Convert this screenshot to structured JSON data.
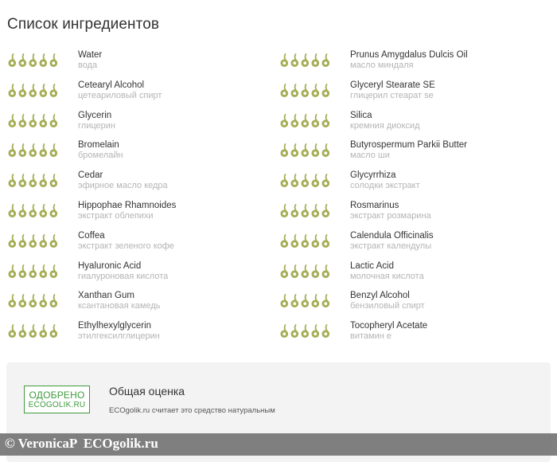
{
  "page": {
    "title": "Список ингредиентов"
  },
  "colors": {
    "drop_fill": "#a5ad55",
    "badge_green": "#3f9a3d"
  },
  "icons": {
    "rating": "drop-icon"
  },
  "ingredients": [
    {
      "name": "Water",
      "translation": "вода",
      "rating": 5
    },
    {
      "name": "Prunus Amygdalus Dulcis Oil",
      "translation": "масло миндаля",
      "rating": 5
    },
    {
      "name": "Cetearyl Alcohol",
      "translation": "цетеариловый спирт",
      "rating": 5
    },
    {
      "name": "Glyceryl Stearate SE",
      "translation": "глицерил стеарат se",
      "rating": 5
    },
    {
      "name": "Glycerin",
      "translation": "глицерин",
      "rating": 5
    },
    {
      "name": "Silica",
      "translation": "кремния диоксид",
      "rating": 5
    },
    {
      "name": "Bromelain",
      "translation": "бромелайн",
      "rating": 5
    },
    {
      "name": "Butyrospermum Parkii Butter",
      "translation": "масло ши",
      "rating": 5
    },
    {
      "name": "Cedar",
      "translation": "эфирное масло кедра",
      "rating": 5
    },
    {
      "name": "Glycyrrhiza",
      "translation": "солодки экстракт",
      "rating": 5
    },
    {
      "name": "Hippophae Rhamnoides",
      "translation": "экстракт облепихи",
      "rating": 5
    },
    {
      "name": "Rosmarinus",
      "translation": "экстракт розмарина",
      "rating": 5
    },
    {
      "name": "Coffea",
      "translation": "экстракт зеленого кофе",
      "rating": 5
    },
    {
      "name": "Calendula Officinalis",
      "translation": "экстракт календулы",
      "rating": 5
    },
    {
      "name": "Hyaluronic Acid",
      "translation": "гиалуроновая кислота",
      "rating": 5
    },
    {
      "name": "Lactic Acid",
      "translation": "молочная кислота",
      "rating": 5
    },
    {
      "name": "Xanthan Gum",
      "translation": "ксантановая камедь",
      "rating": 5
    },
    {
      "name": "Benzyl Alcohol",
      "translation": "бензиловый спирт",
      "rating": 5
    },
    {
      "name": "Ethylhexylglycerin",
      "translation": "этилгексилглицерин",
      "rating": 5
    },
    {
      "name": "Tocopheryl Acetate",
      "translation": "витамин е",
      "rating": 5
    }
  ],
  "summary": {
    "badge_top": "ОДОБРЕНО",
    "badge_bottom": "ECOGOLIK.RU",
    "title": "Общая оценка",
    "text": "ECOgolik.ru считает это средство натуральным"
  },
  "watermark": {
    "text": "© VeronicaP  ECOgolik.ru"
  }
}
